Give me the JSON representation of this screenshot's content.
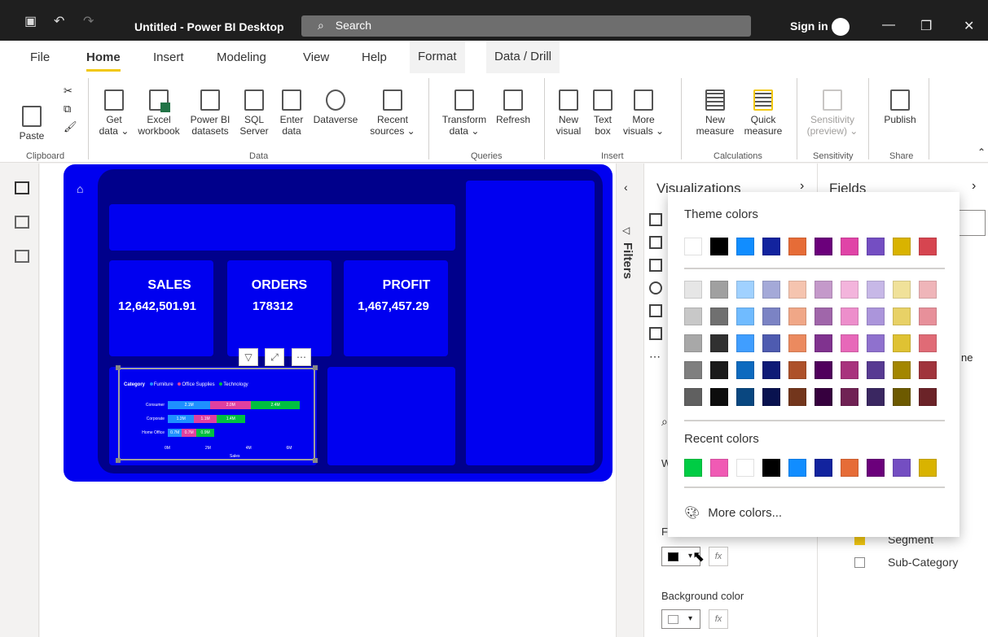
{
  "titlebar": {
    "title": "Untitled - Power BI Desktop",
    "search": "Search",
    "sign_in": "Sign in",
    "minimize": "—",
    "restore": "❐",
    "close": "✕"
  },
  "menu": [
    "File",
    "Home",
    "Insert",
    "Modeling",
    "View",
    "Help",
    "Format",
    "Data / Drill"
  ],
  "ribbon": {
    "clipboard": {
      "paste": "Paste",
      "group": "Clipboard"
    },
    "data": {
      "get_data": [
        "Get",
        "data ⌄"
      ],
      "excel": [
        "Excel",
        "workbook"
      ],
      "pbi_datasets": [
        "Power BI",
        "datasets"
      ],
      "sql": [
        "SQL",
        "Server"
      ],
      "enter_data": [
        "Enter",
        "data"
      ],
      "dataverse": [
        "Dataverse",
        ""
      ],
      "recent": [
        "Recent",
        "sources ⌄"
      ],
      "group": "Data"
    },
    "queries": {
      "transform": [
        "Transform",
        "data ⌄"
      ],
      "refresh": [
        "Refresh",
        ""
      ],
      "group": "Queries"
    },
    "insert": {
      "new_visual": [
        "New",
        "visual"
      ],
      "text_box": [
        "Text",
        "box"
      ],
      "more_visuals": [
        "More",
        "visuals ⌄"
      ],
      "group": "Insert"
    },
    "calculations": {
      "new_measure": [
        "New",
        "measure"
      ],
      "quick_measure": [
        "Quick",
        "measure"
      ],
      "group": "Calculations"
    },
    "sensitivity": {
      "label": [
        "Sensitivity",
        "(preview) ⌄"
      ],
      "group": "Sensitivity"
    },
    "share": {
      "publish": "Publish",
      "group": "Share"
    }
  },
  "kpis": [
    {
      "title": "SALES",
      "value": "12,642,501.91"
    },
    {
      "title": "ORDERS",
      "value": "178312"
    },
    {
      "title": "PROFIT",
      "value": "1,467,457.29"
    }
  ],
  "chart_data": {
    "type": "bar",
    "title": "",
    "legend_title": "Category",
    "series": [
      {
        "name": "Furniture",
        "color": "#1e90ff",
        "values": [
          2.1,
          1.3,
          0.7
        ]
      },
      {
        "name": "Office Supplies",
        "color": "#e040a0",
        "values": [
          2.0,
          1.1,
          0.7
        ]
      },
      {
        "name": "Technology",
        "color": "#00c040",
        "values": [
          2.4,
          1.4,
          0.9
        ]
      }
    ],
    "categories": [
      "Consumer",
      "Corporate",
      "Home Office"
    ],
    "labels": [
      [
        "2.1M",
        "2.0M",
        "2.4M"
      ],
      [
        "1.3M",
        "1.1M",
        "1.4M"
      ],
      [
        "0.7M",
        "0.7M",
        "0.9M"
      ]
    ],
    "xticks": [
      "0M",
      "2M",
      "4M",
      "6M"
    ],
    "xlabel": "Sales",
    "xlim": [
      0,
      6.5
    ]
  },
  "panes": {
    "filters": "Filters",
    "visualizations": "Visualizations",
    "fields": "Fields",
    "field_items": [
      {
        "label": "Segment",
        "checked": true
      },
      {
        "label": "Sub-Category",
        "checked": false
      }
    ],
    "partial_label_w": "W",
    "partial_label_f": "F",
    "partial_text_ne": "ne",
    "background_color": "Background color",
    "fx": "fx"
  },
  "color_picker": {
    "theme_title": "Theme colors",
    "theme_row": [
      "#ffffff",
      "#000000",
      "#118dff",
      "#12239e",
      "#e66c37",
      "#6b007b",
      "#e044a7",
      "#744ec2",
      "#d9b300",
      "#d64550"
    ],
    "shade_rows": [
      [
        "#e6e6e6",
        "#a0a0a0",
        "#a0d1ff",
        "#a4a9d8",
        "#f5c4af",
        "#c499ca",
        "#f3b4dc",
        "#c7b8e7",
        "#f0e199",
        "#efb5b9"
      ],
      [
        "#c8c8c8",
        "#707070",
        "#70bbff",
        "#7b83c4",
        "#f0a787",
        "#a066aa",
        "#ed8ecb",
        "#ab95db",
        "#e8d166",
        "#e7909a"
      ],
      [
        "#a8a8a8",
        "#303030",
        "#409eff",
        "#4e5bb0",
        "#eb8a5f",
        "#80338f",
        "#e768b9",
        "#8f71ce",
        "#dfc233",
        "#e06b76"
      ],
      [
        "#7f7f7f",
        "#1a1a1a",
        "#0d6abf",
        "#0e1a76",
        "#ad512a",
        "#50005c",
        "#a8337d",
        "#573a92",
        "#a38600",
        "#a0343c"
      ],
      [
        "#606060",
        "#0d0d0d",
        "#094780",
        "#09124f",
        "#73361c",
        "#36003e",
        "#702254",
        "#3a2761",
        "#6d5a00",
        "#6b2328"
      ]
    ],
    "recent_title": "Recent colors",
    "recent_row": [
      "#00cc44",
      "#f05ab4",
      "#ffffff",
      "#000000",
      "#118dff",
      "#12239e",
      "#e66c37",
      "#6b007b",
      "#744ec2",
      "#d9b300"
    ],
    "more_colors": "More colors..."
  }
}
